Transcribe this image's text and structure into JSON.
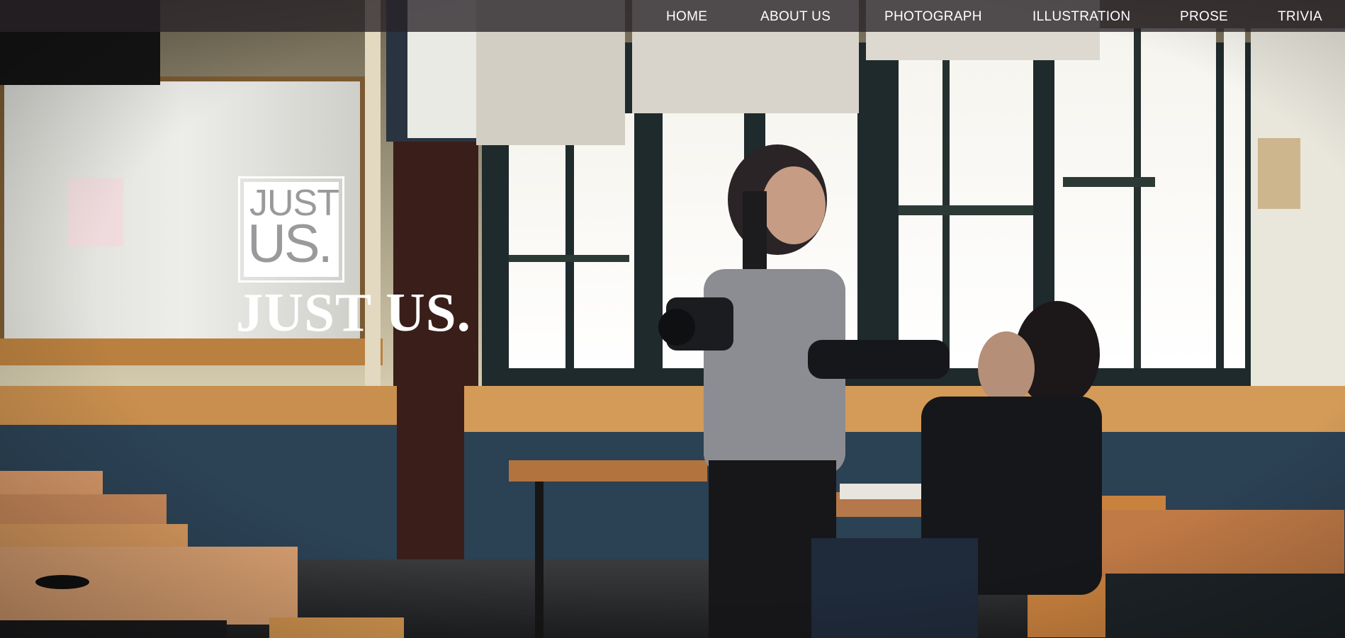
{
  "nav": {
    "items": [
      {
        "label": "HOME"
      },
      {
        "label": "ABOUT US"
      },
      {
        "label": "PHOTOGRAPH"
      },
      {
        "label": "ILLUSTRATION"
      },
      {
        "label": "PROSE"
      },
      {
        "label": "TRIVIA"
      }
    ]
  },
  "logo": {
    "line1": "JUST",
    "line2": "US."
  },
  "hero": {
    "title": "JUST US."
  },
  "colors": {
    "nav_background": "#2a2228",
    "nav_text": "#ffffff",
    "title_text": "#ffffff",
    "logo_gray": "#9a9a9a"
  }
}
